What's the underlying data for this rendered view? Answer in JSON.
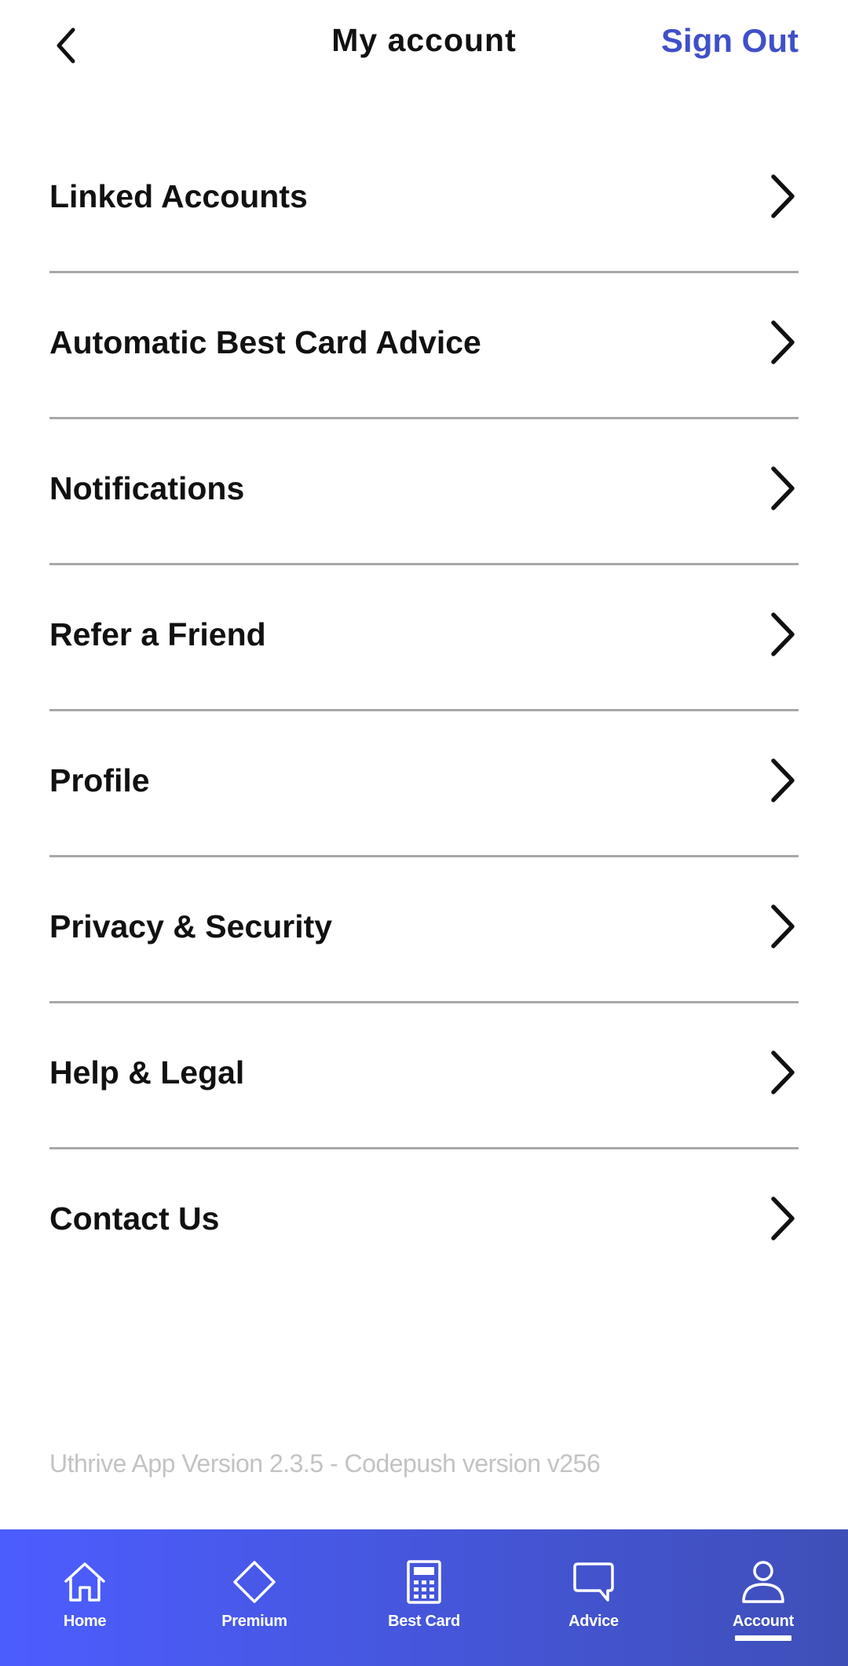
{
  "header": {
    "title": "My account",
    "sign_out_label": "Sign Out",
    "back_icon": "chevron-left-icon"
  },
  "colors": {
    "accent": "#4050c8",
    "tabbar_gradient_start": "#4c5dff",
    "tabbar_gradient_end": "#3f4fb8",
    "divider": "#a8a8a8",
    "version_text": "#c3c3c3"
  },
  "menu": {
    "items": [
      {
        "label": "Linked Accounts",
        "icon": "chevron-right-icon"
      },
      {
        "label": "Automatic Best Card Advice",
        "icon": "chevron-right-icon"
      },
      {
        "label": "Notifications",
        "icon": "chevron-right-icon"
      },
      {
        "label": "Refer a Friend",
        "icon": "chevron-right-icon"
      },
      {
        "label": "Profile",
        "icon": "chevron-right-icon"
      },
      {
        "label": "Privacy & Security",
        "icon": "chevron-right-icon"
      },
      {
        "label": "Help & Legal",
        "icon": "chevron-right-icon"
      },
      {
        "label": "Contact Us",
        "icon": "chevron-right-icon"
      }
    ]
  },
  "footer": {
    "version_text": "Uthrive App Version 2.3.5 - Codepush version v256"
  },
  "tabbar": {
    "tabs": [
      {
        "label": "Home",
        "icon": "home-icon",
        "active": false
      },
      {
        "label": "Premium",
        "icon": "diamond-icon",
        "active": false
      },
      {
        "label": "Best Card",
        "icon": "calculator-icon",
        "active": false
      },
      {
        "label": "Advice",
        "icon": "chat-bubble-icon",
        "active": false
      },
      {
        "label": "Account",
        "icon": "person-icon",
        "active": true
      }
    ]
  }
}
